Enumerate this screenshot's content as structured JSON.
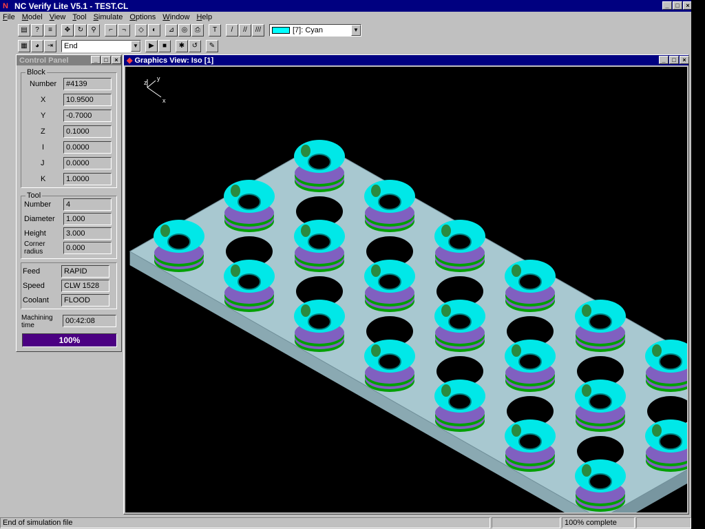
{
  "window": {
    "title": "NC Verify Lite  V5.1  - TEST.CL"
  },
  "menu": [
    "File",
    "Model",
    "View",
    "Tool",
    "Simulate",
    "Options",
    "Window",
    "Help"
  ],
  "toolbar": {
    "color_value": "[7]: Cyan",
    "color_swatch": "#00ffff",
    "position_value": "End"
  },
  "control_panel": {
    "title": "Control Panel",
    "block": {
      "title": "Block",
      "rows": [
        {
          "label": "Number",
          "value": "#4139"
        },
        {
          "label": "X",
          "value": "10.9500"
        },
        {
          "label": "Y",
          "value": "-0.7000"
        },
        {
          "label": "Z",
          "value": "0.1000"
        },
        {
          "label": "I",
          "value": "0.0000"
        },
        {
          "label": "J",
          "value": "0.0000"
        },
        {
          "label": "K",
          "value": "1.0000"
        }
      ]
    },
    "tool": {
      "title": "Tool",
      "rows": [
        {
          "label": "Number",
          "value": "4"
        },
        {
          "label": "Diameter",
          "value": "1.000"
        },
        {
          "label": "Height",
          "value": "3.000"
        },
        {
          "label": "Corner radius",
          "value": "0.000"
        }
      ]
    },
    "misc": {
      "rows": [
        {
          "label": "Feed",
          "value": "RAPID"
        },
        {
          "label": "Speed",
          "value": "CLW 1528"
        },
        {
          "label": "Coolant",
          "value": "FLOOD"
        }
      ]
    },
    "machining_time": {
      "label": "Machining time",
      "value": "00:42:08"
    },
    "progress": {
      "text": "100%",
      "fraction": 1.0
    }
  },
  "graphics_view": {
    "title": "Graphics View: Iso [1]",
    "axes": {
      "z": "z",
      "y": "y",
      "x": "x"
    },
    "colors": {
      "plate": "#a8c8d0",
      "cup": "#00e8e8",
      "ring_green": "#00a000",
      "ring_purple": "#8060c0"
    }
  },
  "status": {
    "message": "End of simulation file",
    "progress": "100% complete"
  }
}
